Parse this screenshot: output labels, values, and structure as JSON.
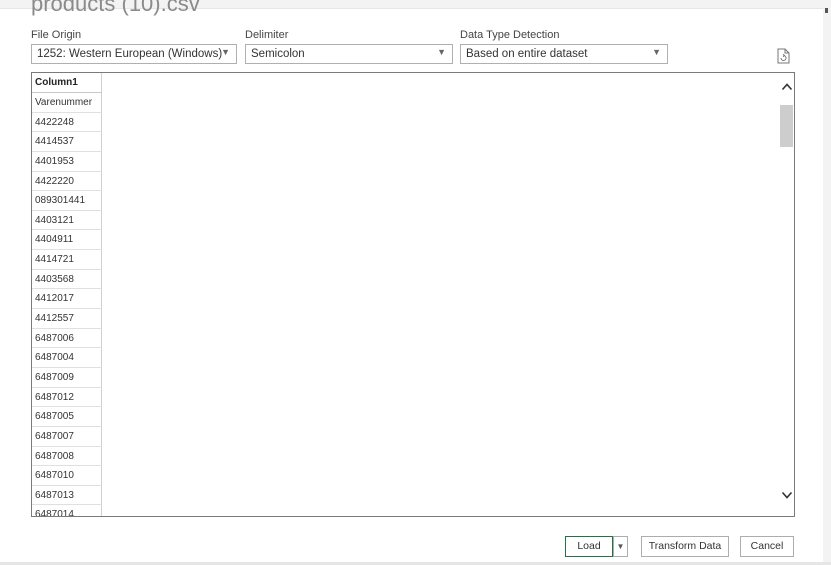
{
  "dialog": {
    "title": "products (10).csv"
  },
  "options": {
    "file_origin": {
      "label": "File Origin",
      "value": "1252: Western European (Windows)"
    },
    "delimiter": {
      "label": "Delimiter",
      "value": "Semicolon"
    },
    "data_type_detection": {
      "label": "Data Type Detection",
      "value": "Based on entire dataset"
    },
    "refresh_icon": "refresh-document-icon"
  },
  "preview": {
    "columns": [
      "Column1"
    ],
    "rows": [
      "Varenummer",
      "4422248",
      "4414537",
      "4401953",
      "4422220",
      "089301441",
      "4403121",
      "4404911",
      "4414721",
      "4403568",
      "4412017",
      "4412557",
      "6487006",
      "6487004",
      "6487009",
      "6487012",
      "6487005",
      "6487007",
      "6487008",
      "6487010",
      "6487013",
      "6487014"
    ]
  },
  "buttons": {
    "load": "Load",
    "load_dropdown_icon": "chevron-down-icon",
    "transform": "Transform Data",
    "cancel": "Cancel"
  },
  "colors": {
    "load_border": "#217346",
    "title": "#8a8a8a"
  }
}
